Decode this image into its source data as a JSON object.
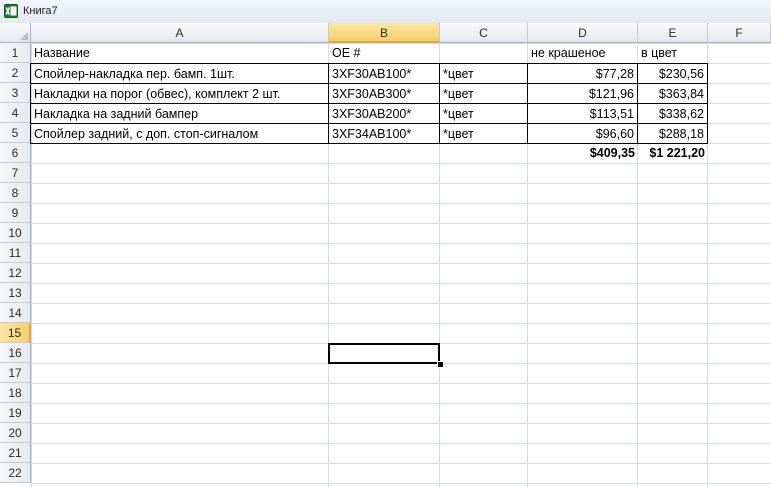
{
  "window": {
    "title": "Книга7"
  },
  "columns": [
    "A",
    "B",
    "C",
    "D",
    "E",
    "F"
  ],
  "rows": [
    "1",
    "2",
    "3",
    "4",
    "5",
    "6",
    "7",
    "8",
    "9",
    "10",
    "11",
    "12",
    "13",
    "14",
    "15",
    "16",
    "17",
    "18",
    "19",
    "20",
    "21",
    "22"
  ],
  "selected": {
    "column": "B",
    "row": "15"
  },
  "table": {
    "headers": [
      "Название",
      "OE #",
      "",
      "не крашеное",
      "в цвет"
    ],
    "data": [
      [
        "Спойлер-накладка пер. бамп. 1шт.",
        "3XF30AB100*",
        "*цвет",
        "$77,28",
        "$230,56"
      ],
      [
        "Накладки на порог (обвес), комплект 2 шт.",
        "3XF30AB300*",
        "*цвет",
        "$121,96",
        "$363,84"
      ],
      [
        "Накладка на задний бампер",
        "3XF30AB200*",
        "*цвет",
        "$113,51",
        "$338,62"
      ],
      [
        "Спойлер задний, с доп. стоп-сигналом",
        "3XF34AB100*",
        "*цвет",
        "$96,60",
        "$288,18"
      ]
    ],
    "totals": {
      "d": "$409,35",
      "e": "$1 221,20"
    }
  },
  "colors": {
    "selected_header": "#f6cf6a",
    "gridline": "#d7dbe1"
  }
}
